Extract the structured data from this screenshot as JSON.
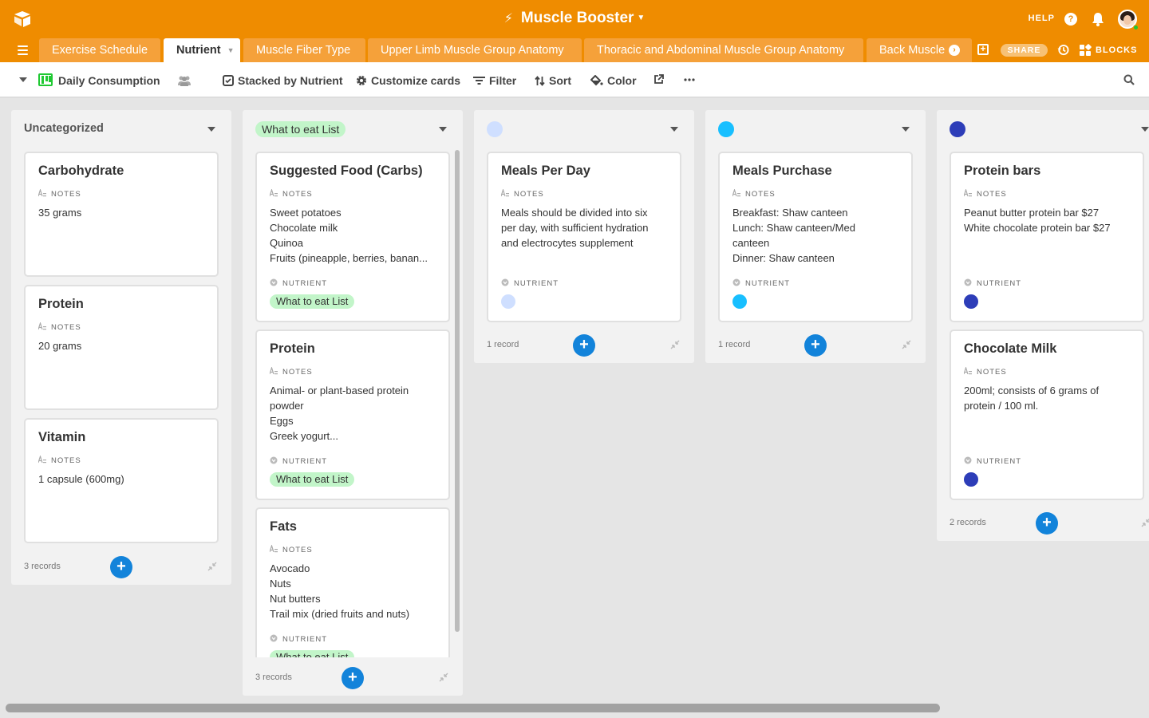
{
  "app": {
    "base_title": "Muscle Booster",
    "help_label": "HELP"
  },
  "tabs": [
    {
      "label": "Exercise Schedule"
    },
    {
      "label": "Nutrient"
    },
    {
      "label": "Muscle Fiber Type"
    },
    {
      "label": "Upper Limb Muscle Group Anatomy"
    },
    {
      "label": "Thoracic and Abdominal Muscle Group Anatomy"
    },
    {
      "label": "Back Muscle"
    }
  ],
  "tab_actions": {
    "share_label": "SHARE",
    "blocks_label": "BLOCKS"
  },
  "toolbar": {
    "view_name": "Daily Consumption",
    "stacked_label": "Stacked by Nutrient",
    "customize_label": "Customize cards",
    "filter_label": "Filter",
    "sort_label": "Sort",
    "color_label": "Color"
  },
  "field_labels": {
    "notes": "NOTES",
    "nutrient": "NUTRIENT"
  },
  "colors": {
    "brand": "#ef8c00",
    "accent_blue": "#1283da",
    "pill_green": "#c2f5c9",
    "dot_light_blue": "#cfdfff",
    "dot_cyan": "#18bfff",
    "dot_dark_blue": "#2d3db8"
  },
  "columns": [
    {
      "header": "Uncategorized",
      "record_count": "3 records",
      "cards": [
        {
          "title": "Carbohydrate",
          "notes": [
            "35 grams"
          ]
        },
        {
          "title": "Protein",
          "notes": [
            "20 grams"
          ]
        },
        {
          "title": "Vitamin",
          "notes": [
            "1 capsule (600mg)"
          ]
        }
      ]
    },
    {
      "header": "What to eat List",
      "record_count": "3 records",
      "cards": [
        {
          "title": "Suggested Food (Carbs)",
          "notes": [
            "Sweet potatoes",
            "Chocolate milk",
            "Quinoa",
            "Fruits (pineapple, berries, banan..."
          ],
          "nutrient": "What to eat List"
        },
        {
          "title": "Protein",
          "notes": [
            "Animal- or plant-based protein",
            "powder",
            "Eggs",
            "Greek yogurt..."
          ],
          "nutrient": "What to eat List"
        },
        {
          "title": "Fats",
          "notes": [
            "Avocado",
            "Nuts",
            "Nut butters",
            "Trail mix (dried fruits and nuts)"
          ],
          "nutrient": "What to eat List"
        }
      ]
    },
    {
      "header": "",
      "header_color": "#cfdfff",
      "record_count": "1 record",
      "cards": [
        {
          "title": "Meals Per Day",
          "notes": [
            "Meals should be divided into six",
            "per day, with sufficient hydration",
            "and electrocytes supplement"
          ],
          "nutrient_color": "#cfdfff"
        }
      ]
    },
    {
      "header": "",
      "header_color": "#18bfff",
      "record_count": "1 record",
      "cards": [
        {
          "title": "Meals Purchase",
          "notes": [
            "Breakfast: Shaw canteen",
            "Lunch: Shaw canteen/Med",
            "canteen",
            "Dinner: Shaw canteen"
          ],
          "nutrient_color": "#18bfff"
        }
      ]
    },
    {
      "header": "",
      "header_color": "#2d3db8",
      "record_count": "2 records",
      "cards": [
        {
          "title": "Protein bars",
          "notes": [
            "Peanut butter protein bar $27",
            "White chocolate protein bar $27"
          ],
          "nutrient_color": "#2d3db8"
        },
        {
          "title": "Chocolate Milk",
          "notes": [
            "200ml; consists of 6 grams of",
            "protein / 100 ml."
          ],
          "nutrient_color": "#2d3db8"
        }
      ]
    }
  ]
}
